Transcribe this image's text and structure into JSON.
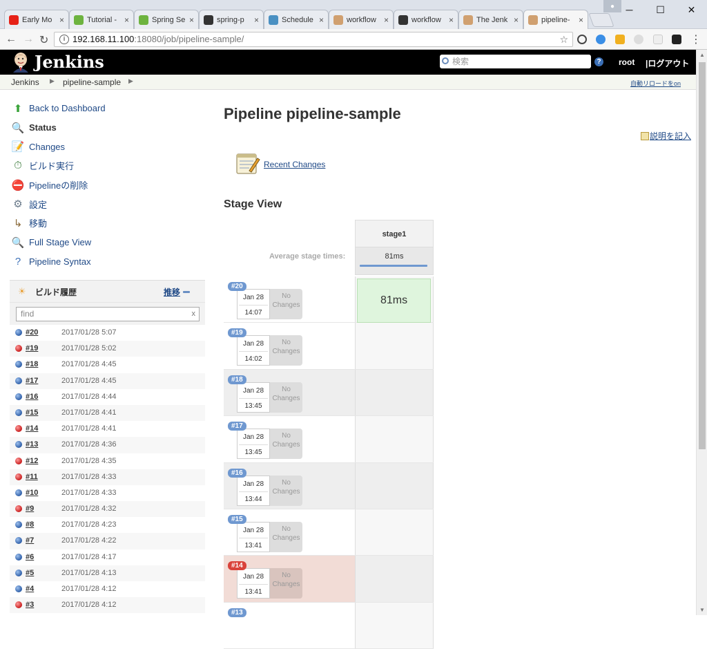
{
  "browser": {
    "tabs": [
      {
        "label": "Early Mo",
        "icon": "youtube-icon",
        "color": "#e62117"
      },
      {
        "label": "Tutorial -",
        "icon": "spring-icon",
        "color": "#6db33f"
      },
      {
        "label": "Spring Se",
        "icon": "spring-icon",
        "color": "#6db33f"
      },
      {
        "label": "spring-p",
        "icon": "github-icon",
        "color": "#333333"
      },
      {
        "label": "Schedule",
        "icon": "s-icon",
        "color": "#4a90c2"
      },
      {
        "label": "workflow",
        "icon": "jenkins-icon",
        "color": "#d0a070"
      },
      {
        "label": "workflow",
        "icon": "github-icon",
        "color": "#333333"
      },
      {
        "label": "The Jenk",
        "icon": "jenkins-icon",
        "color": "#d0a070"
      },
      {
        "label": "pipeline-",
        "icon": "jenkins-icon",
        "color": "#d0a070"
      }
    ],
    "url_host": "192.168.11.100",
    "url_rest": ":18080/job/pipeline-sample/"
  },
  "jenkins": {
    "title": "Jenkins",
    "search_placeholder": "検索",
    "user": "root",
    "logout": "|ログアウト",
    "breadcrumb": [
      "Jenkins",
      "pipeline-sample"
    ],
    "auto_refresh": "自動リロードをon"
  },
  "tasks": [
    {
      "label": "Back to Dashboard",
      "icon": "up-arrow-icon",
      "glyph": "⬆",
      "color": "#3aa33a"
    },
    {
      "label": "Status",
      "icon": "magnifier-icon",
      "glyph": "🔍",
      "color": "#4a6fa5"
    },
    {
      "label": "Changes",
      "icon": "notepad-icon",
      "glyph": "📝",
      "color": "#b28b3a"
    },
    {
      "label": "ビルド実行",
      "icon": "clock-build-icon",
      "glyph": "⏱",
      "color": "#3a7a3a"
    },
    {
      "label": "Pipelineの削除",
      "icon": "no-entry-icon",
      "glyph": "⛔",
      "color": "#d9433b"
    },
    {
      "label": "設定",
      "icon": "gear-icon",
      "glyph": "⚙",
      "color": "#6a7a8a"
    },
    {
      "label": "移動",
      "icon": "move-icon",
      "glyph": "↳",
      "color": "#8a6a3a"
    },
    {
      "label": "Full Stage View",
      "icon": "magnifier-icon",
      "glyph": "🔍",
      "color": "#4a6fa5"
    },
    {
      "label": "Pipeline Syntax",
      "icon": "help-icon",
      "glyph": "?",
      "color": "#3b6fb6"
    }
  ],
  "build_history": {
    "title": "ビルド履歴",
    "trend": "推移",
    "filter_placeholder": "find",
    "filter_clear": "x",
    "builds": [
      {
        "num": "#20",
        "date": "2017/01/28 5:07",
        "status": "blue"
      },
      {
        "num": "#19",
        "date": "2017/01/28 5:02",
        "status": "red"
      },
      {
        "num": "#18",
        "date": "2017/01/28 4:45",
        "status": "blue"
      },
      {
        "num": "#17",
        "date": "2017/01/28 4:45",
        "status": "blue"
      },
      {
        "num": "#16",
        "date": "2017/01/28 4:44",
        "status": "blue"
      },
      {
        "num": "#15",
        "date": "2017/01/28 4:41",
        "status": "blue"
      },
      {
        "num": "#14",
        "date": "2017/01/28 4:41",
        "status": "red"
      },
      {
        "num": "#13",
        "date": "2017/01/28 4:36",
        "status": "blue"
      },
      {
        "num": "#12",
        "date": "2017/01/28 4:35",
        "status": "red"
      },
      {
        "num": "#11",
        "date": "2017/01/28 4:33",
        "status": "red"
      },
      {
        "num": "#10",
        "date": "2017/01/28 4:33",
        "status": "blue"
      },
      {
        "num": "#9",
        "date": "2017/01/28 4:32",
        "status": "red"
      },
      {
        "num": "#8",
        "date": "2017/01/28 4:23",
        "status": "blue"
      },
      {
        "num": "#7",
        "date": "2017/01/28 4:22",
        "status": "blue"
      },
      {
        "num": "#6",
        "date": "2017/01/28 4:17",
        "status": "blue"
      },
      {
        "num": "#5",
        "date": "2017/01/28 4:13",
        "status": "blue"
      },
      {
        "num": "#4",
        "date": "2017/01/28 4:12",
        "status": "blue"
      },
      {
        "num": "#3",
        "date": "2017/01/28 4:12",
        "status": "red"
      }
    ]
  },
  "main": {
    "title": "Pipeline pipeline-sample",
    "edit_description": "説明を記入",
    "recent_changes": "Recent Changes",
    "stage_view_title": "Stage View",
    "stage_name": "stage1",
    "avg_label": "Average stage times:",
    "avg_time": "81ms",
    "no_changes": "No Changes",
    "runs": [
      {
        "num": "#20",
        "date": "Jan 28",
        "time": "14:07",
        "stage": "81ms",
        "status": "success"
      },
      {
        "num": "#19",
        "date": "Jan 28",
        "time": "14:02",
        "stage": "",
        "status": "unknown"
      },
      {
        "num": "#18",
        "date": "Jan 28",
        "time": "13:45",
        "stage": "",
        "status": "unknown"
      },
      {
        "num": "#17",
        "date": "Jan 28",
        "time": "13:45",
        "stage": "",
        "status": "unknown"
      },
      {
        "num": "#16",
        "date": "Jan 28",
        "time": "13:44",
        "stage": "",
        "status": "unknown"
      },
      {
        "num": "#15",
        "date": "Jan 28",
        "time": "13:41",
        "stage": "",
        "status": "unknown"
      },
      {
        "num": "#14",
        "date": "Jan 28",
        "time": "13:41",
        "stage": "",
        "status": "failed"
      },
      {
        "num": "#13",
        "date": "",
        "time": "",
        "stage": "",
        "status": "unknown"
      }
    ]
  }
}
